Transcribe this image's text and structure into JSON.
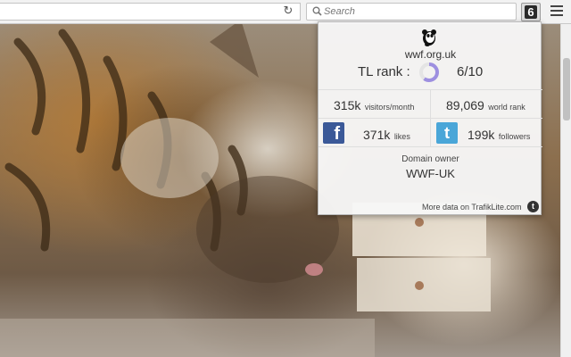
{
  "toolbar": {
    "search_placeholder": "Search",
    "extension_badge": "6",
    "reload_icon": "reload-icon",
    "menu_icon": "hamburger-menu-icon"
  },
  "popup": {
    "logo_icon": "wwf-panda-icon",
    "domain": "wwf.org.uk",
    "rank_label": "TL rank :",
    "rank_value": "6/10",
    "rank_fraction": 0.6,
    "visitors_value": "315k",
    "visitors_label": "visitors/month",
    "world_rank_value": "89,069",
    "world_rank_label": "world rank",
    "facebook_icon_letter": "f",
    "likes_value": "371k",
    "likes_label": "likes",
    "twitter_icon_letter": "t",
    "followers_value": "199k",
    "followers_label": "followers",
    "owner_label": "Domain owner",
    "owner_value": "WWF-UK",
    "more_link": "More data on TrafikLite.com",
    "tl_icon_letter": "t"
  },
  "colors": {
    "facebook": "#3b5998",
    "twitter": "#4aa6d8",
    "rank_ring": "#9d8fe0"
  }
}
